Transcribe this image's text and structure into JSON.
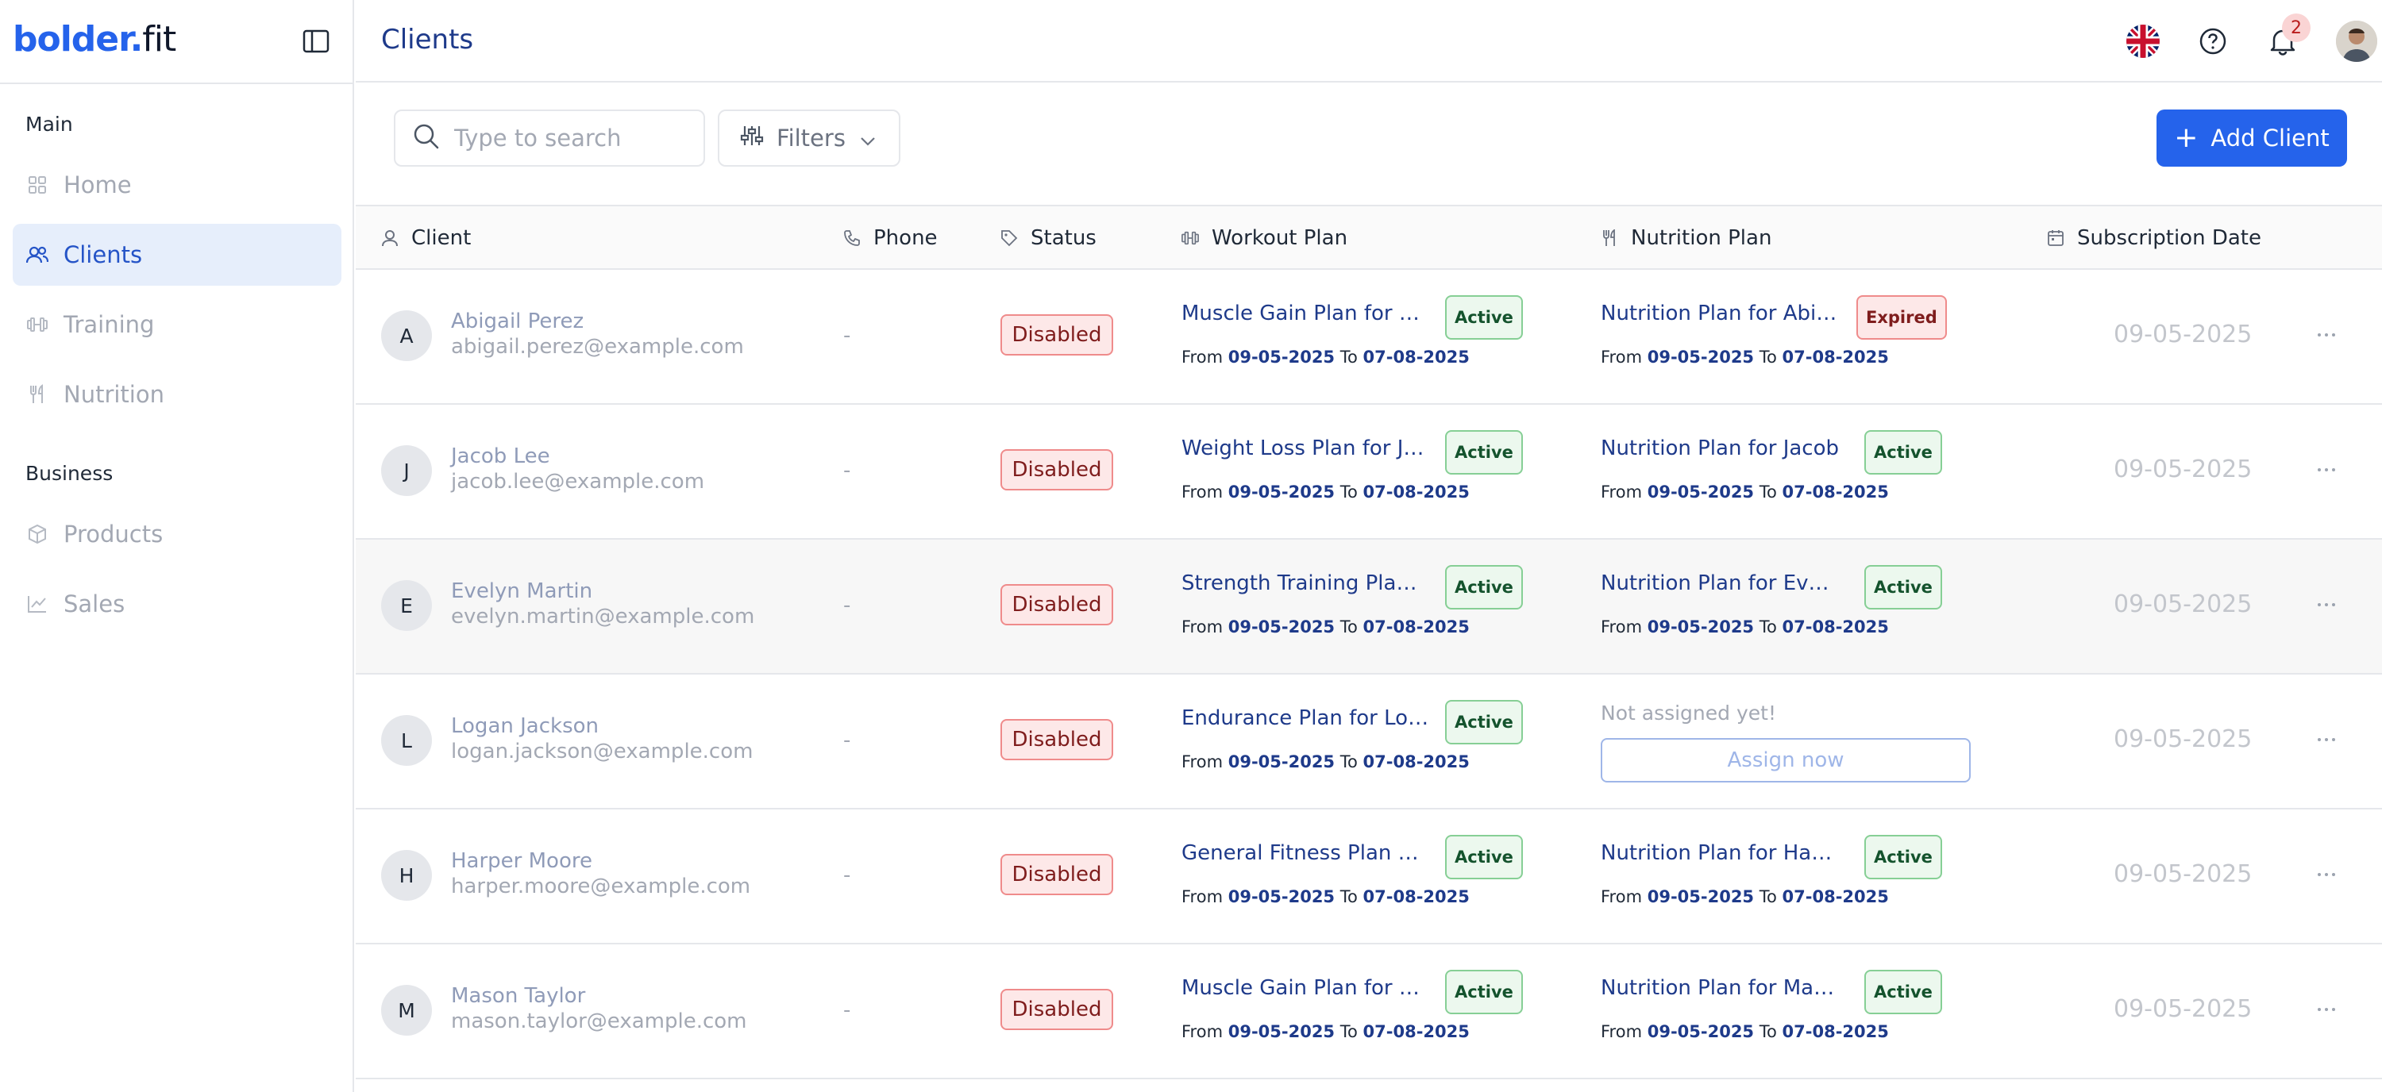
{
  "brand": {
    "part1": "bolder.",
    "part2": "fit"
  },
  "header": {
    "title": "Clients",
    "notifications_count": "2"
  },
  "sidebar": {
    "sections": [
      {
        "label": "Main"
      },
      {
        "label": "Business"
      }
    ],
    "items": [
      {
        "label": "Home",
        "icon": "grid-icon"
      },
      {
        "label": "Clients",
        "icon": "users-icon",
        "active": true
      },
      {
        "label": "Training",
        "icon": "dumbbell-icon"
      },
      {
        "label": "Nutrition",
        "icon": "utensils-icon"
      },
      {
        "label": "Products",
        "icon": "package-icon"
      },
      {
        "label": "Sales",
        "icon": "chart-line-icon"
      }
    ]
  },
  "toolbar": {
    "search_placeholder": "Type to search",
    "filters_label": "Filters",
    "add_client_label": "Add Client"
  },
  "table": {
    "columns": [
      "Client",
      "Phone",
      "Status",
      "Workout Plan",
      "Nutrition Plan",
      "Subscription Date"
    ],
    "from_label": "From",
    "to_label": "To",
    "rows": [
      {
        "initial": "A",
        "name": "Abigail Perez",
        "email": "abigail.perez@example.com",
        "phone": "-",
        "status": "Disabled",
        "workout": {
          "name": "Muscle Gain Plan for Abi…",
          "status": "Active",
          "from": "09-05-2025",
          "to": "07-08-2025"
        },
        "nutrition": {
          "name": "Nutrition Plan for Abigail",
          "status": "Expired",
          "from": "09-05-2025",
          "to": "07-08-2025"
        },
        "subscription": "09-05-2025"
      },
      {
        "initial": "J",
        "name": "Jacob Lee",
        "email": "jacob.lee@example.com",
        "phone": "-",
        "status": "Disabled",
        "workout": {
          "name": "Weight Loss Plan for Jac…",
          "status": "Active",
          "from": "09-05-2025",
          "to": "07-08-2025"
        },
        "nutrition": {
          "name": "Nutrition Plan for Jacob",
          "status": "Active",
          "from": "09-05-2025",
          "to": "07-08-2025"
        },
        "subscription": "09-05-2025"
      },
      {
        "initial": "E",
        "name": "Evelyn Martin",
        "email": "evelyn.martin@example.com",
        "phone": "-",
        "status": "Disabled",
        "workout": {
          "name": "Strength Training Plan fo…",
          "status": "Active",
          "from": "09-05-2025",
          "to": "07-08-2025"
        },
        "nutrition": {
          "name": "Nutrition Plan for Evelyn",
          "status": "Active",
          "from": "09-05-2025",
          "to": "07-08-2025"
        },
        "subscription": "09-05-2025"
      },
      {
        "initial": "L",
        "name": "Logan Jackson",
        "email": "logan.jackson@example.com",
        "phone": "-",
        "status": "Disabled",
        "workout": {
          "name": "Endurance Plan for Logan",
          "status": "Active",
          "from": "09-05-2025",
          "to": "07-08-2025"
        },
        "nutrition": {
          "not_assigned": "Not assigned yet!",
          "assign_label": "Assign now"
        },
        "subscription": "09-05-2025"
      },
      {
        "initial": "H",
        "name": "Harper Moore",
        "email": "harper.moore@example.com",
        "phone": "-",
        "status": "Disabled",
        "workout": {
          "name": "General Fitness Plan for …",
          "status": "Active",
          "from": "09-05-2025",
          "to": "07-08-2025"
        },
        "nutrition": {
          "name": "Nutrition Plan for Harper",
          "status": "Active",
          "from": "09-05-2025",
          "to": "07-08-2025"
        },
        "subscription": "09-05-2025"
      },
      {
        "initial": "M",
        "name": "Mason Taylor",
        "email": "mason.taylor@example.com",
        "phone": "-",
        "status": "Disabled",
        "workout": {
          "name": "Muscle Gain Plan for Mas…",
          "status": "Active",
          "from": "09-05-2025",
          "to": "07-08-2025"
        },
        "nutrition": {
          "name": "Nutrition Plan for Mason",
          "status": "Active",
          "from": "09-05-2025",
          "to": "07-08-2025"
        },
        "subscription": "09-05-2025"
      }
    ]
  },
  "colors": {
    "accent": "#2563eb",
    "disabled": "#fde8e8",
    "active": "#ecf8ee"
  }
}
